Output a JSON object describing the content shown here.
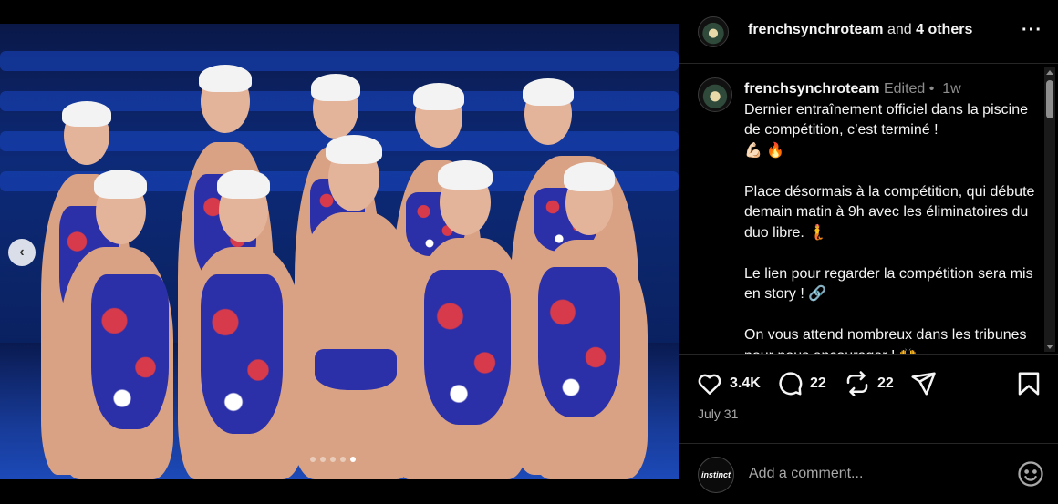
{
  "media": {
    "carousel_dots": 5,
    "active_dot": 4
  },
  "header": {
    "username": "frenchsynchroteam",
    "and_text": " and ",
    "others": "4 others",
    "more_icon": "more-horizontal-icon"
  },
  "caption": {
    "username": "frenchsynchroteam",
    "edited": "Edited",
    "sep": " • ",
    "time": "1w",
    "line1": "Dernier entraînement officiel dans la piscine de compétition, c’est terminé !",
    "emoji1": "💪🏻 🔥",
    "para2": "Place désormais à la compétition, qui débute demain matin à 9h avec les éliminatoires du duo libre. 🧜",
    "para3": "Le lien pour regarder la compétition sera mis en story ! 🔗",
    "para4": "On vous attend nombreux dans les tribunes pour nous encourager ! 🙌 ..."
  },
  "actions": {
    "likes": "3.4K",
    "comments": "22",
    "reposts": "22"
  },
  "date": "July 31",
  "comment": {
    "avatar_text": "instinct",
    "placeholder": "Add a comment..."
  },
  "colors": {
    "background": "#000000",
    "divider": "#262626",
    "muted": "#8e8e8e"
  }
}
